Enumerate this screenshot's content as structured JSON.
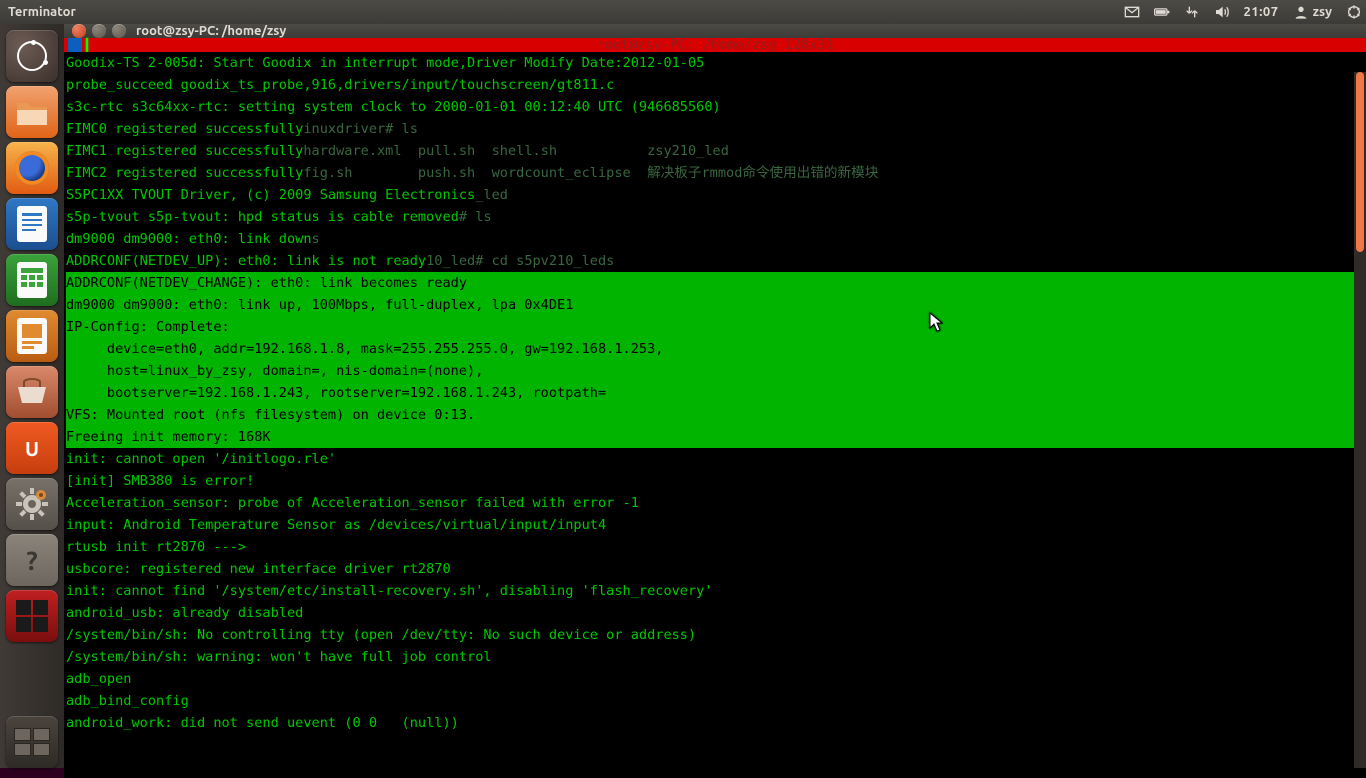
{
  "top_panel": {
    "app_title": "Terminator",
    "clock": "21:07",
    "user": "zsy"
  },
  "launcher": {
    "items": [
      {
        "name": "dash",
        "label": "Dash"
      },
      {
        "name": "files",
        "label": "Files"
      },
      {
        "name": "firefox",
        "label": "Firefox"
      },
      {
        "name": "writer",
        "label": "LibreOffice Writer"
      },
      {
        "name": "calc",
        "label": "LibreOffice Calc"
      },
      {
        "name": "impress",
        "label": "LibreOffice Impress"
      },
      {
        "name": "software",
        "label": "Ubuntu Software Center"
      },
      {
        "name": "ubuntu-one",
        "label": "Ubuntu One"
      },
      {
        "name": "settings",
        "label": "System Settings"
      },
      {
        "name": "help",
        "label": "Help"
      },
      {
        "name": "terminator",
        "label": "Terminator"
      },
      {
        "name": "workspace",
        "label": "Workspace Switcher"
      }
    ]
  },
  "window": {
    "title": "root@zsy-PC: /home/zsy",
    "status_title": "root@zsy-PC: /home/zsy 128x31"
  },
  "terminal": {
    "lines": [
      "Goodix-TS 2-005d: Start Goodix in interrupt mode,Driver Modify Date:2012-01-05",
      "probe_succeed goodix_ts_probe,916,drivers/input/touchscreen/gt811.c",
      "s3c-rtc s3c64xx-rtc: setting system clock to 2000-01-01 00:12:40 UTC (946685560)",
      "FIMC0 registered successfully",
      "FIMC1 registered successfully",
      "FIMC2 registered successfully",
      "S5PC1XX TVOUT Driver, (c) 2009 Samsung Electronics",
      "s5p-tvout s5p-tvout: hpd status is cable removed",
      "dm9000 dm9000: eth0: link down",
      "ADDRCONF(NETDEV_UP): eth0: link is not ready"
    ],
    "hl_lines": [
      "ADDRCONF(NETDEV_CHANGE): eth0: link becomes ready",
      "dm9000 dm9000: eth0: link up, 100Mbps, full-duplex, lpa 0x4DE1",
      "IP-Config: Complete:",
      "     device=eth0, addr=192.168.1.8, mask=255.255.255.0, gw=192.168.1.253,",
      "     host=linux_by_zsy, domain=, nis-domain=(none),",
      "     bootserver=192.168.1.243, rootserver=192.168.1.243, rootpath=",
      "VFS: Mounted root (nfs filesystem) on device 0:13.",
      "Freeing init memory: 168K"
    ],
    "lines2": [
      "init: cannot open '/initlogo.rle'",
      "[init] SMB380 is error!",
      "Acceleration_sensor: probe of Acceleration_sensor failed with error -1",
      "input: Android Temperature Sensor as /devices/virtual/input/input4",
      "rtusb init rt2870 --->",
      "usbcore: registered new interface driver rt2870",
      "init: cannot find '/system/etc/install-recovery.sh', disabling 'flash_recovery'",
      "android_usb: already disabled",
      "/system/bin/sh: No controlling tty (open /dev/tty: No such device or address)",
      "/system/bin/sh: warning: won't have full job control",
      "adb_open",
      "adb_bind_config",
      "android_work: did not send uevent (0 0   (null))"
    ],
    "ghost": {
      "l1_a": "inuxdriver# ls",
      "l2_a": "hardware.xml  pull.sh  shell.sh           zsy210_led",
      "l3_a": "fig.sh        push.sh  wordcount_eclipse  解决板子rmmod命令使用出错的新模块",
      "l4_a": "_led",
      "l5_a": "# ls",
      "l6_a": "s",
      "l7_a": "10_led# cd s5pv210_leds"
    }
  }
}
